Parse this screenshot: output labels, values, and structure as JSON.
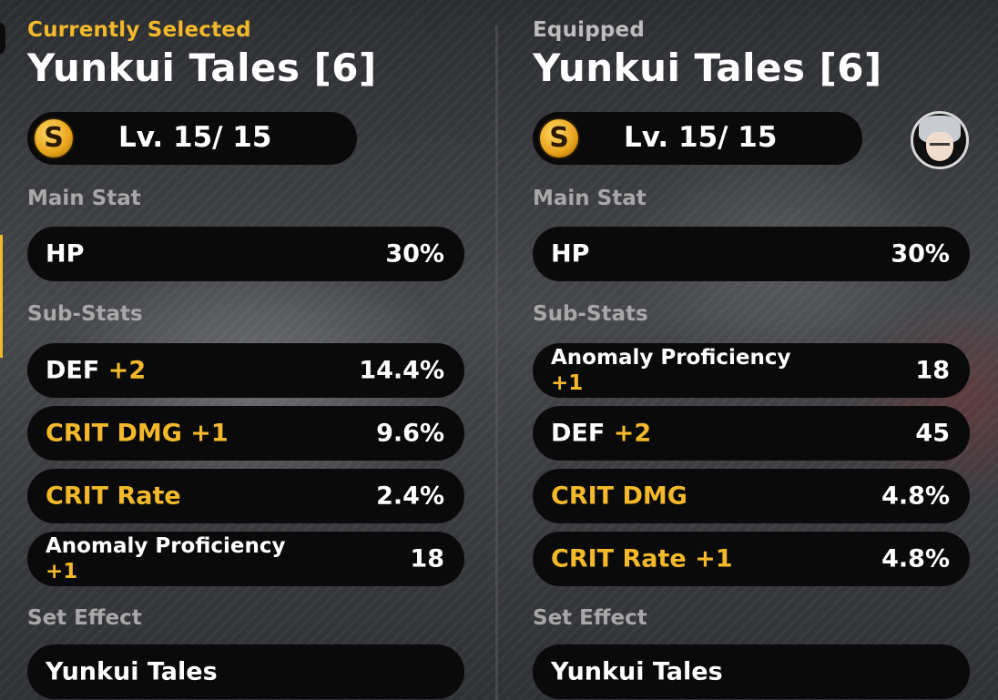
{
  "left": {
    "eyebrow": "Currently Selected",
    "title": "Yunkui Tales [6]",
    "rarity_badge": "S",
    "level": "Lv. 15/ 15",
    "main_stat_label": "Main Stat",
    "main_stat": {
      "name": "HP",
      "value": "30%"
    },
    "sub_stats_label": "Sub-Stats",
    "sub_stats": [
      {
        "name": "DEF",
        "upgrade": "+2",
        "value": "14.4%"
      },
      {
        "name": "CRIT DMG +1",
        "value": "9.6%"
      },
      {
        "name": "CRIT Rate",
        "value": "2.4%"
      },
      {
        "name": "Anomaly Proficiency",
        "upgrade": "+1",
        "value": "18"
      }
    ],
    "set_effect_label": "Set Effect",
    "set_effect": "Yunkui Tales"
  },
  "right": {
    "eyebrow": "Equipped",
    "title": "Yunkui Tales [6]",
    "rarity_badge": "S",
    "level": "Lv. 15/ 15",
    "main_stat_label": "Main Stat",
    "main_stat": {
      "name": "HP",
      "value": "30%"
    },
    "sub_stats_label": "Sub-Stats",
    "sub_stats": [
      {
        "name": "Anomaly Proficiency",
        "upgrade": "+1",
        "value": "18"
      },
      {
        "name": "DEF",
        "upgrade": "+2",
        "value": "45"
      },
      {
        "name": "CRIT DMG",
        "value": "4.8%"
      },
      {
        "name": "CRIT Rate +1",
        "value": "4.8%"
      }
    ],
    "set_effect_label": "Set Effect",
    "set_effect": "Yunkui Tales"
  },
  "colors": {
    "accent": "#f3b92b",
    "row_bg": "#0a0a0a",
    "label": "#a8a8a8"
  },
  "icons": {
    "rarity": "s-rank-badge-icon",
    "avatar": "character-avatar-icon"
  }
}
